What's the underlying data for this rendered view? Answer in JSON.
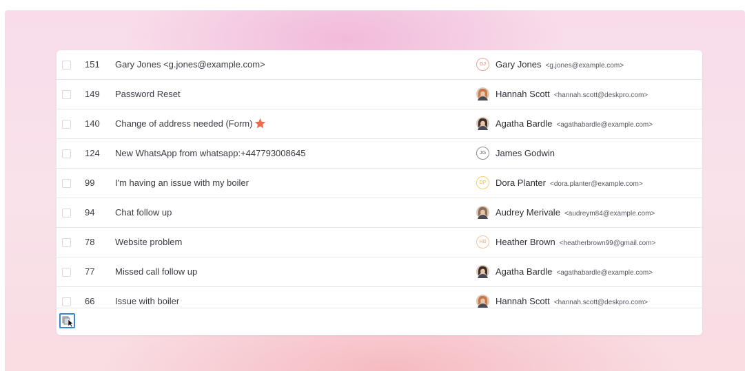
{
  "tickets": [
    {
      "id": "151",
      "subject": "Gary Jones <g.jones@example.com>",
      "starred": false,
      "person": {
        "name": "Gary Jones",
        "email": "<g.jones@example.com>",
        "initials": "GJ",
        "avatar": "initials",
        "color": "#e9a48f"
      }
    },
    {
      "id": "149",
      "subject": "Password Reset",
      "starred": false,
      "person": {
        "name": "Hannah Scott",
        "email": "<hannah.scott@deskpro.com>",
        "initials": "",
        "avatar": "photo",
        "color": "#c9784a"
      }
    },
    {
      "id": "140",
      "subject": "Change of address needed (Form)",
      "starred": true,
      "person": {
        "name": "Agatha Bardle",
        "email": "<agathabardle@example.com>",
        "initials": "",
        "avatar": "photo",
        "color": "#3e2c27"
      }
    },
    {
      "id": "124",
      "subject": "New WhatsApp from whatsapp:+447793008645",
      "starred": false,
      "person": {
        "name": "James Godwin",
        "email": "",
        "initials": "JG",
        "avatar": "initials",
        "color": "#8a8a92"
      }
    },
    {
      "id": "99",
      "subject": "I'm having an issue with my boiler",
      "starred": false,
      "person": {
        "name": "Dora Planter",
        "email": "<dora.planter@example.com>",
        "initials": "DP",
        "avatar": "initials",
        "color": "#f2cf72"
      }
    },
    {
      "id": "94",
      "subject": "Chat follow up",
      "starred": false,
      "person": {
        "name": "Audrey Merivale",
        "email": "<audreym84@example.com>",
        "initials": "",
        "avatar": "photo",
        "color": "#8a6e55"
      }
    },
    {
      "id": "78",
      "subject": "Website problem",
      "starred": false,
      "person": {
        "name": "Heather Brown",
        "email": "<heatherbrown99@gmail.com>",
        "initials": "HB",
        "avatar": "initials",
        "color": "#f0c49a"
      }
    },
    {
      "id": "77",
      "subject": "Missed call follow up",
      "starred": false,
      "person": {
        "name": "Agatha Bardle",
        "email": "<agathabardle@example.com>",
        "initials": "",
        "avatar": "photo",
        "color": "#3e2c27"
      }
    },
    {
      "id": "66",
      "subject": "Issue with boiler",
      "starred": false,
      "person": {
        "name": "Hannah Scott",
        "email": "<hannah.scott@deskpro.com>",
        "initials": "",
        "avatar": "photo",
        "color": "#c9784a"
      }
    }
  ],
  "icons": {
    "star": "star-icon",
    "bulk": "bulk-action-icon"
  },
  "colors": {
    "star": "#ef6a4c",
    "bulk_border": "#3a84d8"
  }
}
